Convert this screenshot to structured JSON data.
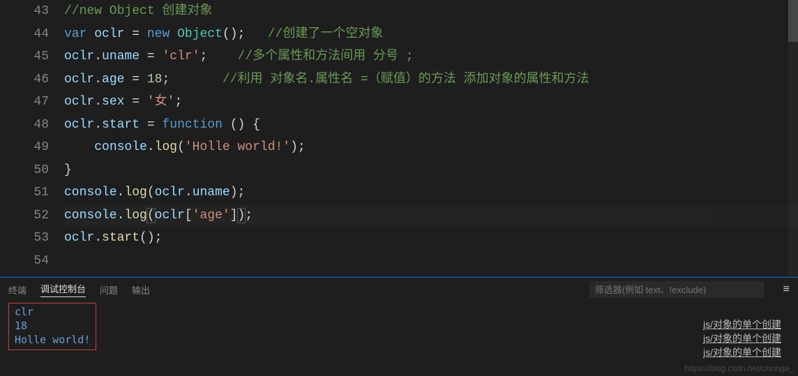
{
  "lines": [
    {
      "n": 43,
      "tokens": [
        [
          "cm",
          "//new Object 创建对象"
        ]
      ]
    },
    {
      "n": 44,
      "tokens": [
        [
          "kw",
          "var"
        ],
        [
          "",
          " "
        ],
        [
          "vr",
          "oclr"
        ],
        [
          "",
          " "
        ],
        [
          "pn",
          "="
        ],
        [
          "",
          " "
        ],
        [
          "kw",
          "new"
        ],
        [
          "",
          " "
        ],
        [
          "tp",
          "Object"
        ],
        [
          "pn",
          "();"
        ],
        [
          "",
          "   "
        ],
        [
          "cm",
          "//创建了一个空对象"
        ]
      ]
    },
    {
      "n": 45,
      "tokens": [
        [
          "vr",
          "oclr"
        ],
        [
          "pn",
          "."
        ],
        [
          "vr",
          "uname"
        ],
        [
          "",
          " "
        ],
        [
          "pn",
          "="
        ],
        [
          "",
          " "
        ],
        [
          "st",
          "'clr'"
        ],
        [
          "pn",
          ";"
        ],
        [
          "",
          "    "
        ],
        [
          "cm",
          "//多个属性和方法间用 分号 ;"
        ]
      ]
    },
    {
      "n": 46,
      "tokens": [
        [
          "vr",
          "oclr"
        ],
        [
          "pn",
          "."
        ],
        [
          "vr",
          "age"
        ],
        [
          "",
          " "
        ],
        [
          "pn",
          "="
        ],
        [
          "",
          " "
        ],
        [
          "nm",
          "18"
        ],
        [
          "pn",
          ";"
        ],
        [
          "",
          "       "
        ],
        [
          "cm",
          "//利用 对象名.属性名 =（赋值）的方法 添加对象的属性和方法"
        ]
      ]
    },
    {
      "n": 47,
      "tokens": [
        [
          "vr",
          "oclr"
        ],
        [
          "pn",
          "."
        ],
        [
          "vr",
          "sex"
        ],
        [
          "",
          " "
        ],
        [
          "pn",
          "="
        ],
        [
          "",
          " "
        ],
        [
          "st",
          "'女'"
        ],
        [
          "pn",
          ";"
        ]
      ]
    },
    {
      "n": 48,
      "tokens": [
        [
          "vr",
          "oclr"
        ],
        [
          "pn",
          "."
        ],
        [
          "vr",
          "start"
        ],
        [
          "",
          " "
        ],
        [
          "pn",
          "="
        ],
        [
          "",
          " "
        ],
        [
          "kw",
          "function"
        ],
        [
          "",
          " "
        ],
        [
          "pn",
          "() {"
        ]
      ]
    },
    {
      "n": 49,
      "tokens": [
        [
          "",
          "    "
        ],
        [
          "vr",
          "console"
        ],
        [
          "pn",
          "."
        ],
        [
          "fn",
          "log"
        ],
        [
          "pn",
          "("
        ],
        [
          "st",
          "'Holle world!'"
        ],
        [
          "pn",
          ");"
        ]
      ]
    },
    {
      "n": 50,
      "tokens": [
        [
          "pn",
          "}"
        ]
      ]
    },
    {
      "n": 51,
      "tokens": [
        [
          "vr",
          "console"
        ],
        [
          "pn",
          "."
        ],
        [
          "fn",
          "log"
        ],
        [
          "pn",
          "("
        ],
        [
          "vr",
          "oclr"
        ],
        [
          "pn",
          "."
        ],
        [
          "vr",
          "uname"
        ],
        [
          "pn",
          ");"
        ]
      ]
    },
    {
      "n": 52,
      "hl": true,
      "tokens": [
        [
          "vr",
          "console"
        ],
        [
          "pn",
          "."
        ],
        [
          "fn",
          "log"
        ],
        [
          "pn br1",
          "("
        ],
        [
          "vr",
          "oclr"
        ],
        [
          "pn",
          "["
        ],
        [
          "st",
          "'age'"
        ],
        [
          "pn",
          "]"
        ],
        [
          "pn br1",
          ")"
        ],
        [
          "pn",
          ";"
        ]
      ]
    },
    {
      "n": 53,
      "tokens": [
        [
          "vr",
          "oclr"
        ],
        [
          "pn",
          "."
        ],
        [
          "fn",
          "start"
        ],
        [
          "pn",
          "();"
        ]
      ]
    },
    {
      "n": 54,
      "tokens": []
    }
  ],
  "panel": {
    "tabs": [
      "终端",
      "调试控制台",
      "问题",
      "输出"
    ],
    "active": 1,
    "filter_placeholder": "筛选器(例如 text、!exclude)",
    "output": [
      "clr",
      "18",
      "Holle world!"
    ],
    "sources": [
      "js/对象的单个创建",
      "js/对象的单个创建",
      "js/对象的单个创建"
    ]
  },
  "watermark": "https://blog.csdn.net/chonga_"
}
